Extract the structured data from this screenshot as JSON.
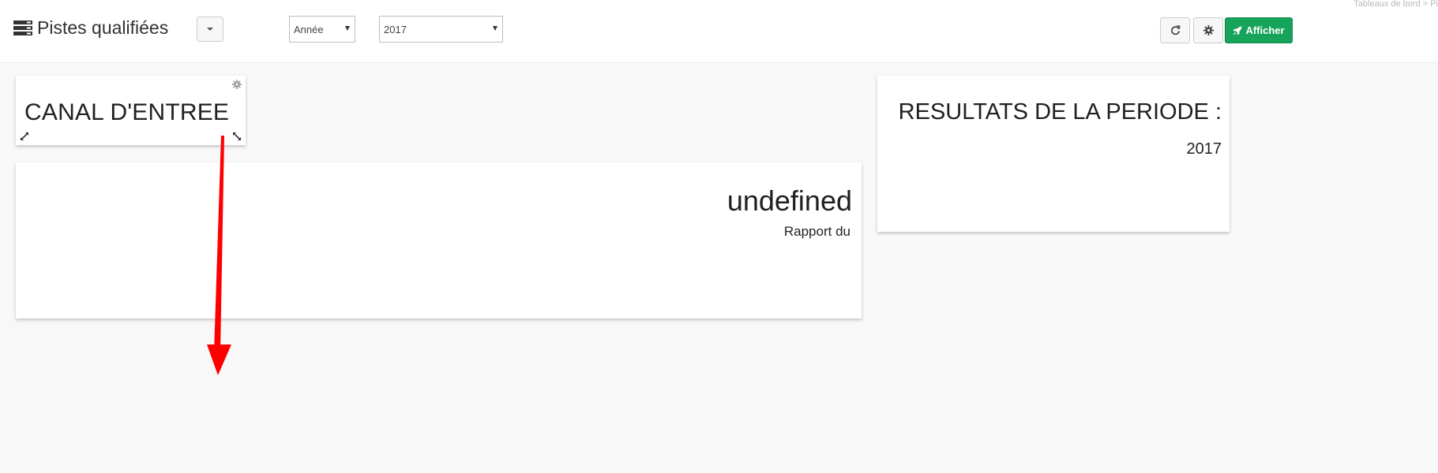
{
  "breadcrumb": "Tableaux de bord > Pi",
  "header": {
    "title": "Pistes qualifiées",
    "title_icon": "list-icon"
  },
  "filters": {
    "period": {
      "selected": "Année"
    },
    "year": {
      "selected": "2017"
    }
  },
  "toolbar": {
    "refresh_icon": "refresh-icon",
    "settings_icon": "gear-icon",
    "afficher_label": "Afficher",
    "afficher_icon": "rocket-icon",
    "accent_color": "#16a35a"
  },
  "widgets": {
    "canal": {
      "title": "CANAL D'ENTREE"
    },
    "report": {
      "value": "undefined",
      "subtitle": "Rapport du"
    },
    "resultats": {
      "title": "RESULTATS DE LA PERIODE :",
      "year": "2017"
    }
  },
  "annotation": {
    "color": "#ff0000",
    "direction": "down"
  }
}
